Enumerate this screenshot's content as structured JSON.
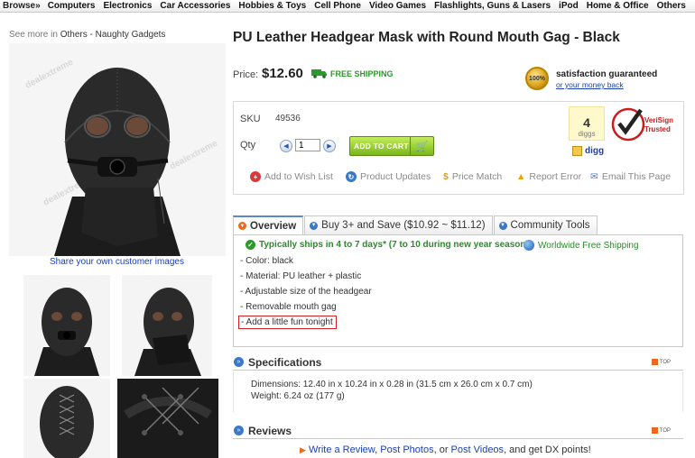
{
  "nav": {
    "browse": "Browse»",
    "items": [
      "Computers",
      "Electronics",
      "Car Accessories",
      "Hobbies & Toys",
      "Cell Phone",
      "Video Games",
      "Flashlights, Guns & Lasers",
      "iPod",
      "Home & Office",
      "Others"
    ]
  },
  "breadcrumb": {
    "prefix": "See more in",
    "category": "Others - Naughty Gadgets"
  },
  "images": {
    "share_link": "Share your own customer images"
  },
  "product": {
    "title": "PU Leather Headgear Mask with Round Mouth Gag - Black",
    "price_label": "Price:",
    "price": "$12.60",
    "free_shipping": "FREE SHIPPING",
    "guarantee_seal": "100%",
    "satisfaction": "satisfaction guaranteed",
    "money_back": "or your money back",
    "sku_label": "SKU",
    "sku": "49536",
    "qty_label": "Qty",
    "qty_value": "1",
    "add_to_cart": "ADD TO CART",
    "diggs_count": "4",
    "diggs_label": "diggs",
    "digg_link": "digg",
    "verisign": [
      "VeriSign",
      "Trusted"
    ]
  },
  "actions": [
    "Add to Wish List",
    "Product Updates",
    "Price Match",
    "Report Error",
    "Email This Page"
  ],
  "tabs": [
    "Overview",
    "Buy 3+ and Save ($10.92 ~ $11.12)",
    "Community Tools"
  ],
  "overview": {
    "ships": "Typically ships in 4 to 7 days* (7 to 10 during new year season)",
    "worldwide": "Worldwide Free Shipping",
    "bullets": [
      "- Color: black",
      "- Material: PU leather + plastic",
      "- Adjustable size of the headgear",
      "- Removable mouth gag",
      "- Add a little fun tonight"
    ]
  },
  "specifications": {
    "title": "Specifications",
    "top": "TOP",
    "dimensions": "Dimensions: 12.40 in x 10.24 in x 0.28 in (31.5 cm x 26.0 cm x 0.7 cm)",
    "weight": "Weight: 6.24 oz (177 g)"
  },
  "reviews": {
    "title": "Reviews",
    "top": "TOP",
    "write": "Write a Review",
    "sep1": ", ",
    "post_photos": "Post Photos",
    "sep2": ", or ",
    "post_videos": "Post Videos",
    "suffix": ", and get DX points!"
  },
  "watermark": "dealextreme",
  "colors": {
    "link": "#1a3fb4",
    "green": "#2a9a2a",
    "orange": "#e86a1a",
    "tab_accent": "#5a88c8"
  }
}
